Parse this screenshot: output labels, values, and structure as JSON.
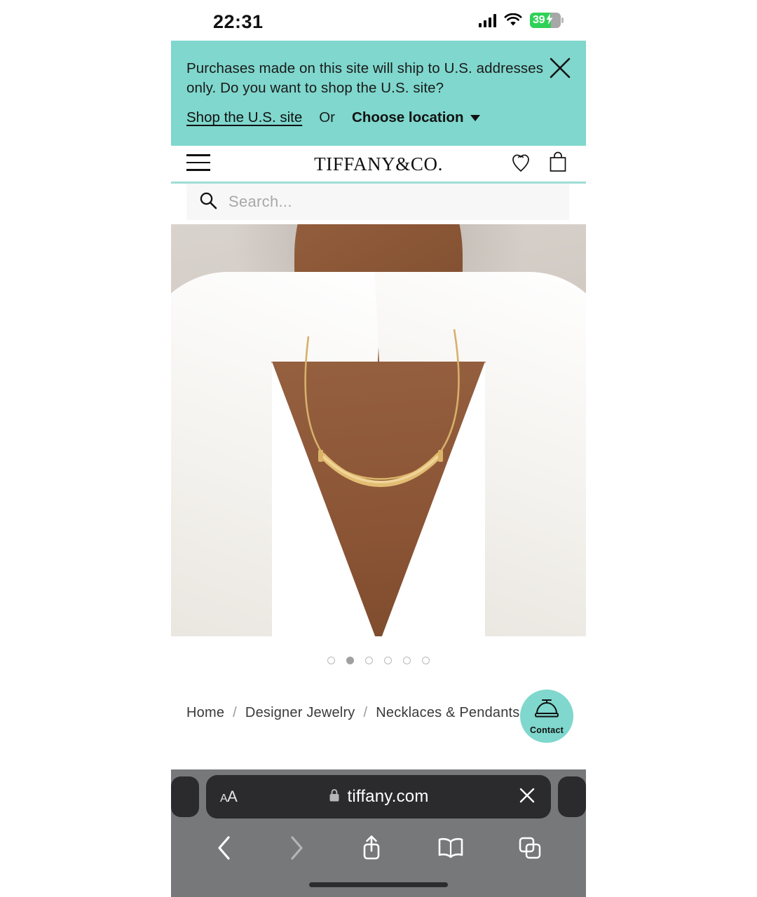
{
  "status_bar": {
    "time": "22:31",
    "cellular_icon": "signal-bars-icon",
    "wifi_icon": "wifi-icon",
    "battery_percent": "39",
    "battery_icon": "battery-charging-icon"
  },
  "geo_banner": {
    "message": "Purchases made on this site will ship to U.S. addresses only. Do you want to shop the U.S. site?",
    "primary_link": "Shop the U.S. site",
    "conjunction": "Or",
    "secondary_link": "Choose location",
    "close_icon": "close-icon",
    "dropdown_icon": "chevron-down-icon",
    "background_color": "#7fd7cd"
  },
  "header": {
    "menu_icon": "hamburger-menu-icon",
    "brand": "TIFFANY&CO.",
    "wishlist_icon": "heart-charm-icon",
    "bag_icon": "shopping-bag-icon",
    "underline_color": "#9fdcd6"
  },
  "search": {
    "icon": "search-icon",
    "placeholder": "Search...",
    "value": ""
  },
  "hero": {
    "alt": "Model wearing gold Tiffany T smile necklace with white v-neck top"
  },
  "carousel": {
    "total": 6,
    "active_index": 1
  },
  "breadcrumb": {
    "items": [
      "Home",
      "Designer Jewelry",
      "Necklaces & Pendants"
    ],
    "separator": "/"
  },
  "contact_button": {
    "label": "Contact",
    "icon": "service-bell-icon",
    "background_color": "#7fd7cd"
  },
  "browser": {
    "text_size_button": "AA",
    "lock_icon": "lock-icon",
    "url": "tiffany.com",
    "close_icon": "close-icon",
    "back_icon": "chevron-left-icon",
    "forward_icon": "chevron-right-icon",
    "share_icon": "share-icon",
    "bookmarks_icon": "book-icon",
    "tabs_icon": "tabs-icon"
  }
}
